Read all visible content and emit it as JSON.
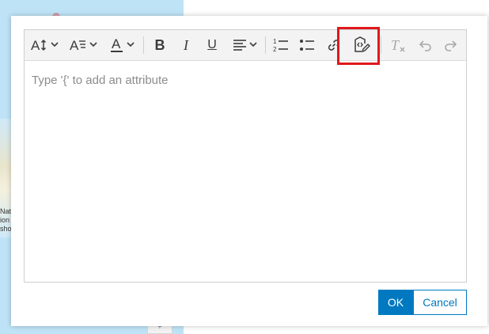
{
  "background": {
    "map_label_text": "Nati\nion\nsho",
    "corner_glyph": "+"
  },
  "editor": {
    "placeholder": "Type '{' to add an attribute"
  },
  "toolbar": {
    "buttons": [
      {
        "name": "font-size",
        "icon": "font-size-icon",
        "glyph": "A↕",
        "has_dropdown": true
      },
      {
        "name": "font-family",
        "icon": "font-family-icon",
        "glyph": "A≡",
        "has_dropdown": true
      },
      {
        "name": "font-color",
        "icon": "font-color-icon",
        "glyph": "A",
        "has_dropdown": true
      },
      {
        "name": "bold",
        "icon": "bold-icon",
        "glyph": "B"
      },
      {
        "name": "italic",
        "icon": "italic-icon",
        "glyph": "I"
      },
      {
        "name": "underline",
        "icon": "underline-icon",
        "glyph": "U"
      },
      {
        "name": "align",
        "icon": "align-left-icon",
        "glyph": "≡",
        "has_dropdown": true
      },
      {
        "name": "numbered-list",
        "icon": "numbered-list-icon",
        "glyph": "1≡"
      },
      {
        "name": "bulleted-list",
        "icon": "bulleted-list-icon",
        "glyph": "•≡"
      },
      {
        "name": "link",
        "icon": "link-icon",
        "glyph": "🔗"
      },
      {
        "name": "edit-source",
        "icon": "code-edit-icon",
        "glyph": "<>"
      },
      {
        "name": "clear-format",
        "icon": "clear-format-icon",
        "glyph": "T",
        "disabled": true
      },
      {
        "name": "undo",
        "icon": "undo-icon",
        "glyph": "↶",
        "disabled": true
      },
      {
        "name": "redo",
        "icon": "redo-icon",
        "glyph": "↷",
        "disabled": true
      }
    ]
  },
  "actions": {
    "ok_label": "OK",
    "cancel_label": "Cancel"
  },
  "colors": {
    "accent": "#0079c1",
    "highlight": "#e0181c"
  }
}
